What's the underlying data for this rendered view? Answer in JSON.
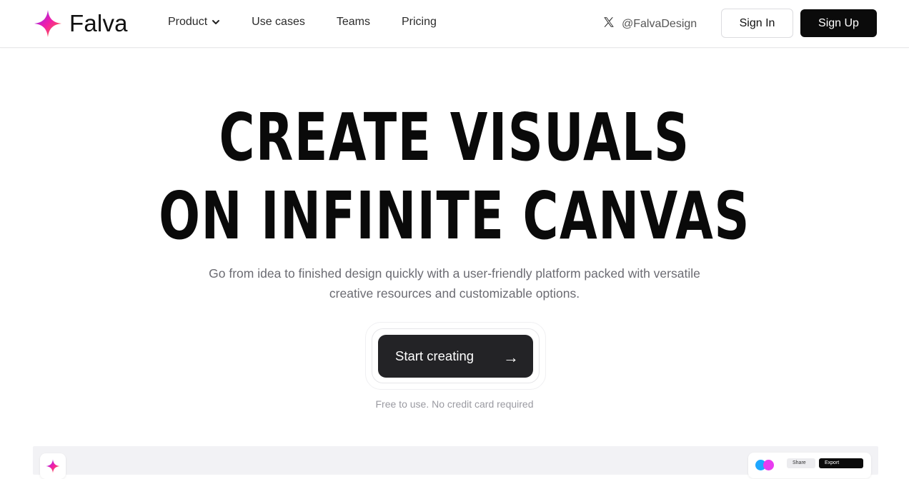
{
  "header": {
    "brand": "Falva",
    "nav": [
      {
        "label": "Product",
        "has_dropdown": true
      },
      {
        "label": "Use cases"
      },
      {
        "label": "Teams"
      },
      {
        "label": "Pricing"
      }
    ],
    "twitter_handle": "@FalvaDesign",
    "sign_in_label": "Sign In",
    "sign_up_label": "Sign Up"
  },
  "hero": {
    "title_line1": "CREATE VISUALS",
    "title_line2": "ON INFINITE CANVAS",
    "subtitle": "Go from idea to finished design quickly with a user-friendly platform packed with versatile creative resources and customizable options.",
    "cta_label": "Start creating",
    "cta_arrow": "→",
    "note": "Free to use. No credit card required"
  },
  "preview": {
    "share_label": "Share",
    "export_label": "Export"
  },
  "colors": {
    "accent_dark": "#0b0b0b",
    "cta_bg": "#232326",
    "logo_pink": "#f21ea8",
    "logo_orange": "#ff7a1a",
    "logo_purple": "#7a2cff",
    "muted_text": "#6b6b72"
  },
  "icons": {
    "logo": "four-point-star-icon",
    "dropdown": "chevron-down-icon",
    "twitter": "x-logo-icon",
    "cta": "arrow-right-icon"
  }
}
